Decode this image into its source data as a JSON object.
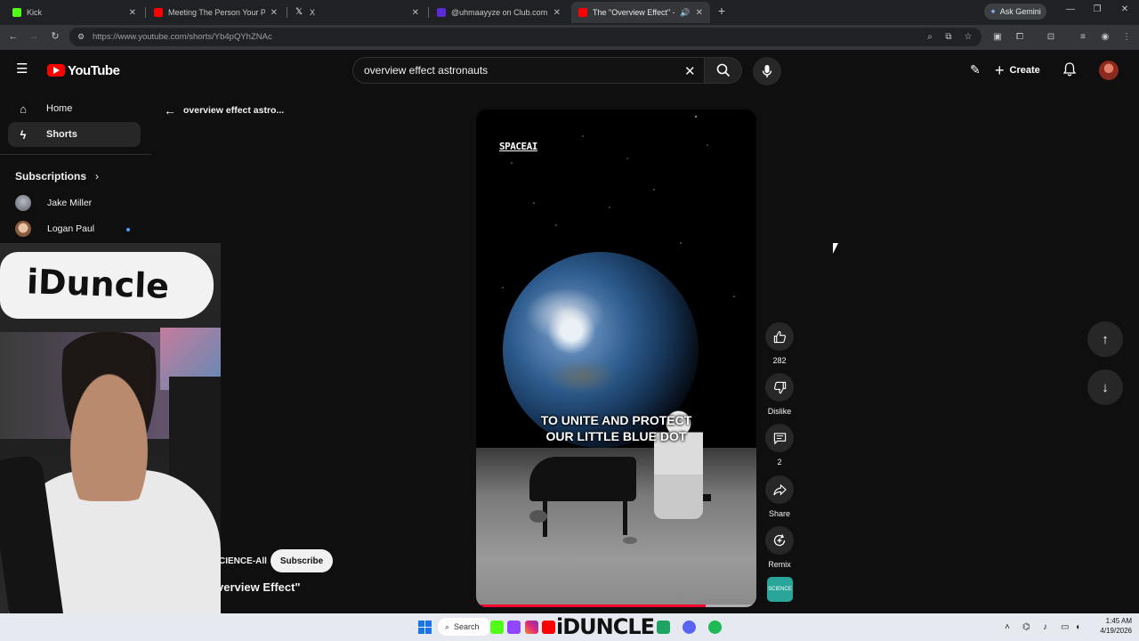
{
  "browser": {
    "tabs": [
      {
        "title": "Kick",
        "favicon_color": "#53fc18",
        "active": false
      },
      {
        "title": "Meeting The Person Your Partn",
        "favicon_color": "#ff0000",
        "active": false
      },
      {
        "title": "X",
        "favicon_color": "#000000",
        "active": false
      },
      {
        "title": "@uhmaayyze on Club.com",
        "favicon_color": "#5b2bd8",
        "active": false
      },
      {
        "title": "The \"Overview Effect\" - You",
        "favicon_color": "#ff0000",
        "active": true
      }
    ],
    "new_tab_icon": "plus-icon",
    "gemini_label": "Ask Gemini",
    "url": "https://www.youtube.com/shorts/Yb4pQYhZNAc"
  },
  "youtube": {
    "logo_text": "YouTube",
    "search": {
      "value": "overview effect astronauts",
      "placeholder": "Search"
    },
    "create_label": "Create",
    "sidebar": {
      "items": [
        {
          "label": "Home",
          "icon": "home-icon"
        },
        {
          "label": "Shorts",
          "icon": "shorts-icon",
          "active": true
        }
      ],
      "subscriptions_title": "Subscriptions",
      "subscriptions": [
        {
          "name": "Jake Miller",
          "avatar_color": "#8a8f99"
        },
        {
          "name": "Logan Paul",
          "avatar_color": "#c49070",
          "live": true
        }
      ]
    },
    "back_label": "overview effect astro...",
    "short": {
      "watermark": "SPACEAI",
      "caption_line1": "TO UNITE AND PROTECT",
      "caption_line2": "OUR LITTLE BLUE DOT",
      "progress": 0.82,
      "channel_name": "CIENCE-All",
      "subscribe_label": "Subscribe",
      "title": "verview Effect\""
    },
    "actions": {
      "likes": "282",
      "dislike_label": "Dislike",
      "comments": "2",
      "share_label": "Share",
      "remix_label": "Remix",
      "channel_thumb_text": "SCIENCE"
    }
  },
  "webcam": {
    "sign_text": "iDuncle"
  },
  "taskbar": {
    "search_label": "Search",
    "overlay_text": "iDUNCLE",
    "time": "1:45 AM",
    "date": "4/19/2026"
  }
}
